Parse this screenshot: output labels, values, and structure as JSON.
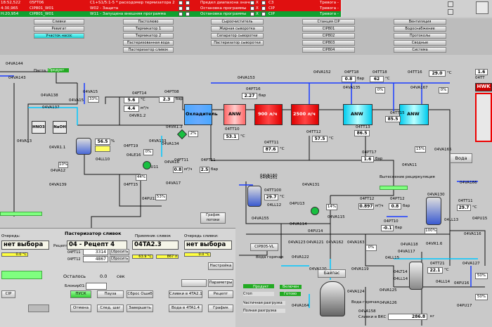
{
  "alarms": [
    {
      "time": "18:52,522",
      "code": "05FT06",
      "msg": "C1+S1/5:1-5 * расходомер термизатора 2",
      "event": "Предел диапазона значен",
      "ack": "X",
      "unit": "C3",
      "state": "Тревога -",
      "color": "red"
    },
    {
      "time": "4:30,965",
      "code": "CIP801_W01",
      "msg": "W02 - Защита",
      "event": "Остановка программы",
      "ack": "X",
      "unit": "CIP",
      "state": "Тревога -",
      "color": "red"
    },
    {
      "time": "H:20,954",
      "code": "CIP801_W01",
      "msg": "W11 - Запущена внешняя программа",
      "event": "Остановка программы",
      "ack": "X",
      "unit": "CIP",
      "state": "Тревога -",
      "color": "green"
    }
  ],
  "nav": {
    "col1": [
      "Сливки",
      "Ревигат",
      "Участок насос"
    ],
    "col2": [
      "Пастолюво",
      "Термикатор 1",
      "Термикатор 2",
      "Пастеризованная вода",
      "Пастеризатор сливок"
    ],
    "col3": [
      "Сыроочиститель",
      "Жирная сыворотка",
      "Сепаратор сыворотки",
      "Пастеризатор сыворотки"
    ],
    "col4": [
      "Станция CIP",
      "CIP801",
      "CIP802",
      "CIP803",
      "CIP804"
    ],
    "col5": [
      "Вентиляция",
      "Водоснабжение",
      "Протоколы",
      "Сводные",
      "Система"
    ]
  },
  "top": {
    "paste_label": "Паста",
    "product_label": "Продукт",
    "chiller": "Охладитель",
    "hex": [
      "ANW",
      "900 л/ч",
      "2500 л/ч",
      "ANW",
      "ANW"
    ],
    "hwk": "HWK"
  },
  "values": {
    "ft14_temp": "5.6",
    "ft14_unit": "°C",
    "ft14_flow": "4.4",
    "ft14_flow_unit": "м³/ч",
    "pt08": "2.3",
    "pt08_unit": "бар",
    "valve15_pct": "33%",
    "pt16": "2.27",
    "pt16_unit": "бар",
    "tt10": "53.1",
    "tt10_unit": "°C",
    "tt11": "87.6",
    "tt12": "57.5",
    "ft18": "0.8",
    "ft18_unit": "бар",
    "tt18": "62",
    "tt16": "29.0",
    "pct0": "0%",
    "pct_a": "0%",
    "tt13": "86.5",
    "tt15": "85.5",
    "t_hwk": "1.6",
    "pt17": "1.6",
    "pct15": "15%",
    "pct2": "2%",
    "lvl_tank1": "56.5",
    "lvl_tank2": "88",
    "pct10": "10%",
    "pct44": "44%",
    "pct53": "53%",
    "ft11": "0.8",
    "pt11": "2.5",
    "tt100": "29.7",
    "ft12": "0.897",
    "pt12": "0.8",
    "pt10": "-0.1",
    "tt11b": "29.7",
    "tt21": "22.1",
    "pct100": "100%",
    "pct14": "14%",
    "pct0b": "0%",
    "pct50": "50%",
    "pct50b": "50%"
  },
  "panel": {
    "queue_label": "Очередь:",
    "title": "Пастеризатор сливок",
    "recipe_label": "Рецепт:",
    "recipe": "04 - Рецепт 4",
    "receive_label": "Приемник сливок",
    "receiver": "04TA2.3",
    "queue2_label": "Очередь сливки:",
    "queue_value": "нет выбора",
    "queue2_value": "нет выбора",
    "t1_tag": "04FT11",
    "t1_val": "3314",
    "t2_tag": "04FT12",
    "t2_val": "4867",
    "reset1": "Сбросить",
    "reset2": "Сбросить",
    "remaining_label": "Осталось",
    "remaining_val": "0.0",
    "remaining_unit": "сек",
    "block_label": "Блокир01:",
    "cip": "CIP",
    "pusk": "ПУСК",
    "pauza": "Пауза",
    "reset_err": "Сброс Ошиб",
    "slivki_to": "Сливки в 4TA2.1",
    "parametry": "Параметры",
    "recept": "Рецепт",
    "otmena": "Отмена",
    "next_step": "След. шаг",
    "finish": "Завершить",
    "water_to": "Вода в 4TA1.4",
    "grafik": "График",
    "nastroika": "Настройка",
    "graph_flows": "График потоки"
  },
  "bottom": {
    "cip_label": "CIP805-VL",
    "water_hot": "Вода горячая",
    "bypass": "Байпас",
    "product": "Продукт",
    "enabled": "Включен",
    "stop": "Стоп",
    "ready": "Готово",
    "partial": "Частичная разгрузка",
    "full": "Полная разгрузка",
    "slivki_vks": "Сливки в ВКС",
    "slivki_val": "286.8",
    "slivki_unit": "кг",
    "water": "Вода",
    "vytesnenie": "Вытеснение рециркуляция",
    "water_hot2": "Вода горячая"
  }
}
